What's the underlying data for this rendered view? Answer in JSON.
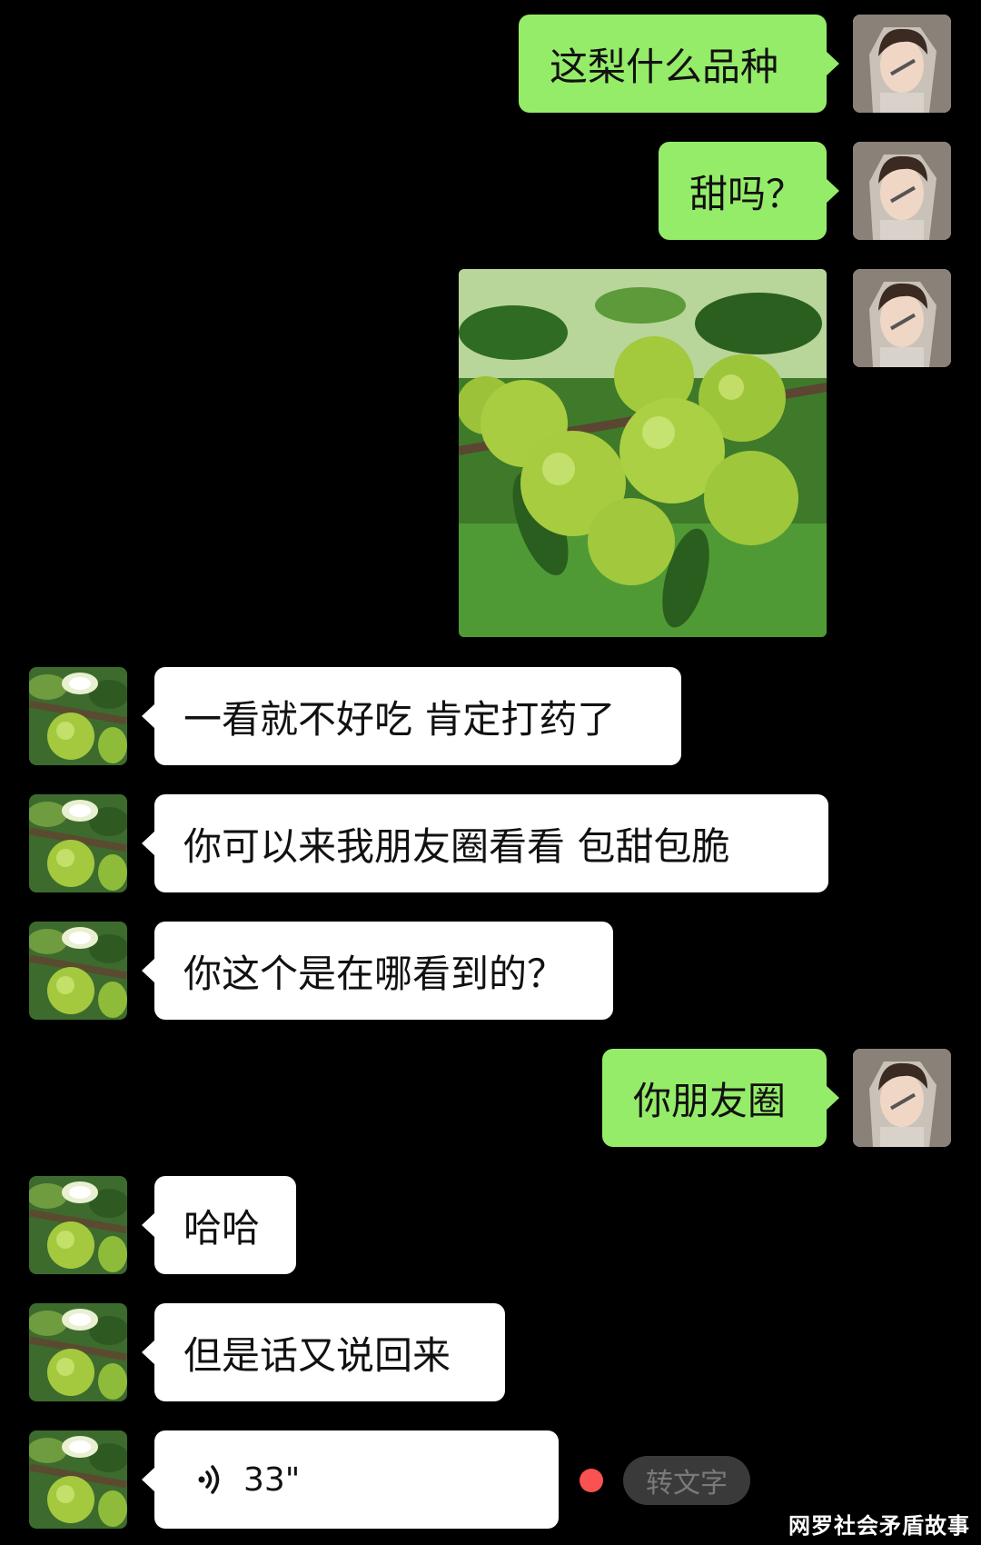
{
  "messages": [
    {
      "text": "这梨什么品种"
    },
    {
      "text": "甜吗？"
    },
    {
      "image": "pear-tree-photo"
    },
    {
      "text": "一看就不好吃 肯定打药了"
    },
    {
      "text": "你可以来我朋友圈看看 包甜包脆"
    },
    {
      "text": "你这个是在哪看到的？"
    },
    {
      "text": "你朋友圈"
    },
    {
      "text": "哈哈"
    },
    {
      "text": "但是话又说回来"
    },
    {
      "voice_duration": "33\"",
      "convert_label": "转文字"
    }
  ],
  "watermark": "网罗社会矛盾故事",
  "colors": {
    "background": "#000000",
    "my_bubble": "#95ec69",
    "their_bubble": "#ffffff",
    "unread_dot": "#fa5151"
  },
  "icons": {
    "voice": "sound-wave-icon",
    "my_avatar": "user-avatar",
    "their_avatar": "pear-avatar"
  }
}
